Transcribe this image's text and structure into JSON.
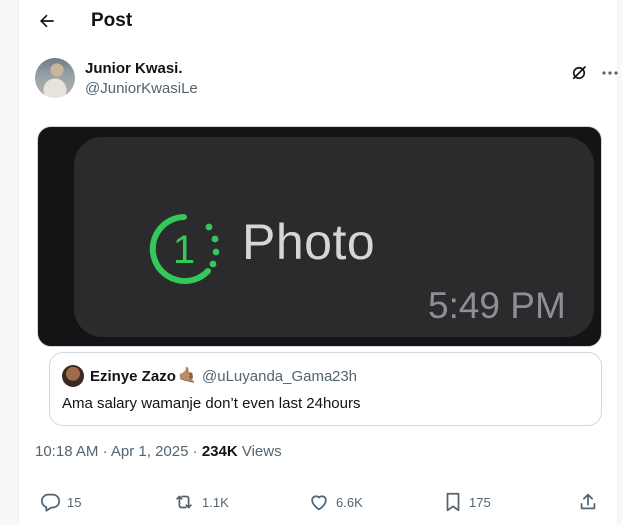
{
  "header": {
    "title": "Post"
  },
  "author": {
    "display_name": "Junior Kwasi.",
    "handle": "@JuniorKwasiLe"
  },
  "media": {
    "label": "Photo",
    "time": "5:49 PM",
    "ring_digit": "1"
  },
  "quote": {
    "display_name": "Ezinye Zazo",
    "emoji": "🤙🏽",
    "handle": "@uLuyanda_Gama",
    "dot": "·",
    "time": "23h",
    "text": "Ama salary wamanje don’t even last 24hours"
  },
  "meta": {
    "time": "10:18 AM",
    "sep": "·",
    "date": "Apr 1, 2025",
    "views_count": "234K",
    "views_label": "Views"
  },
  "actions": {
    "replies": "15",
    "reposts": "1.1K",
    "likes": "6.6K",
    "bookmarks": "175"
  },
  "colors": {
    "accent_green": "#34c759",
    "muted_text": "#536471",
    "border": "#cfd9de"
  }
}
